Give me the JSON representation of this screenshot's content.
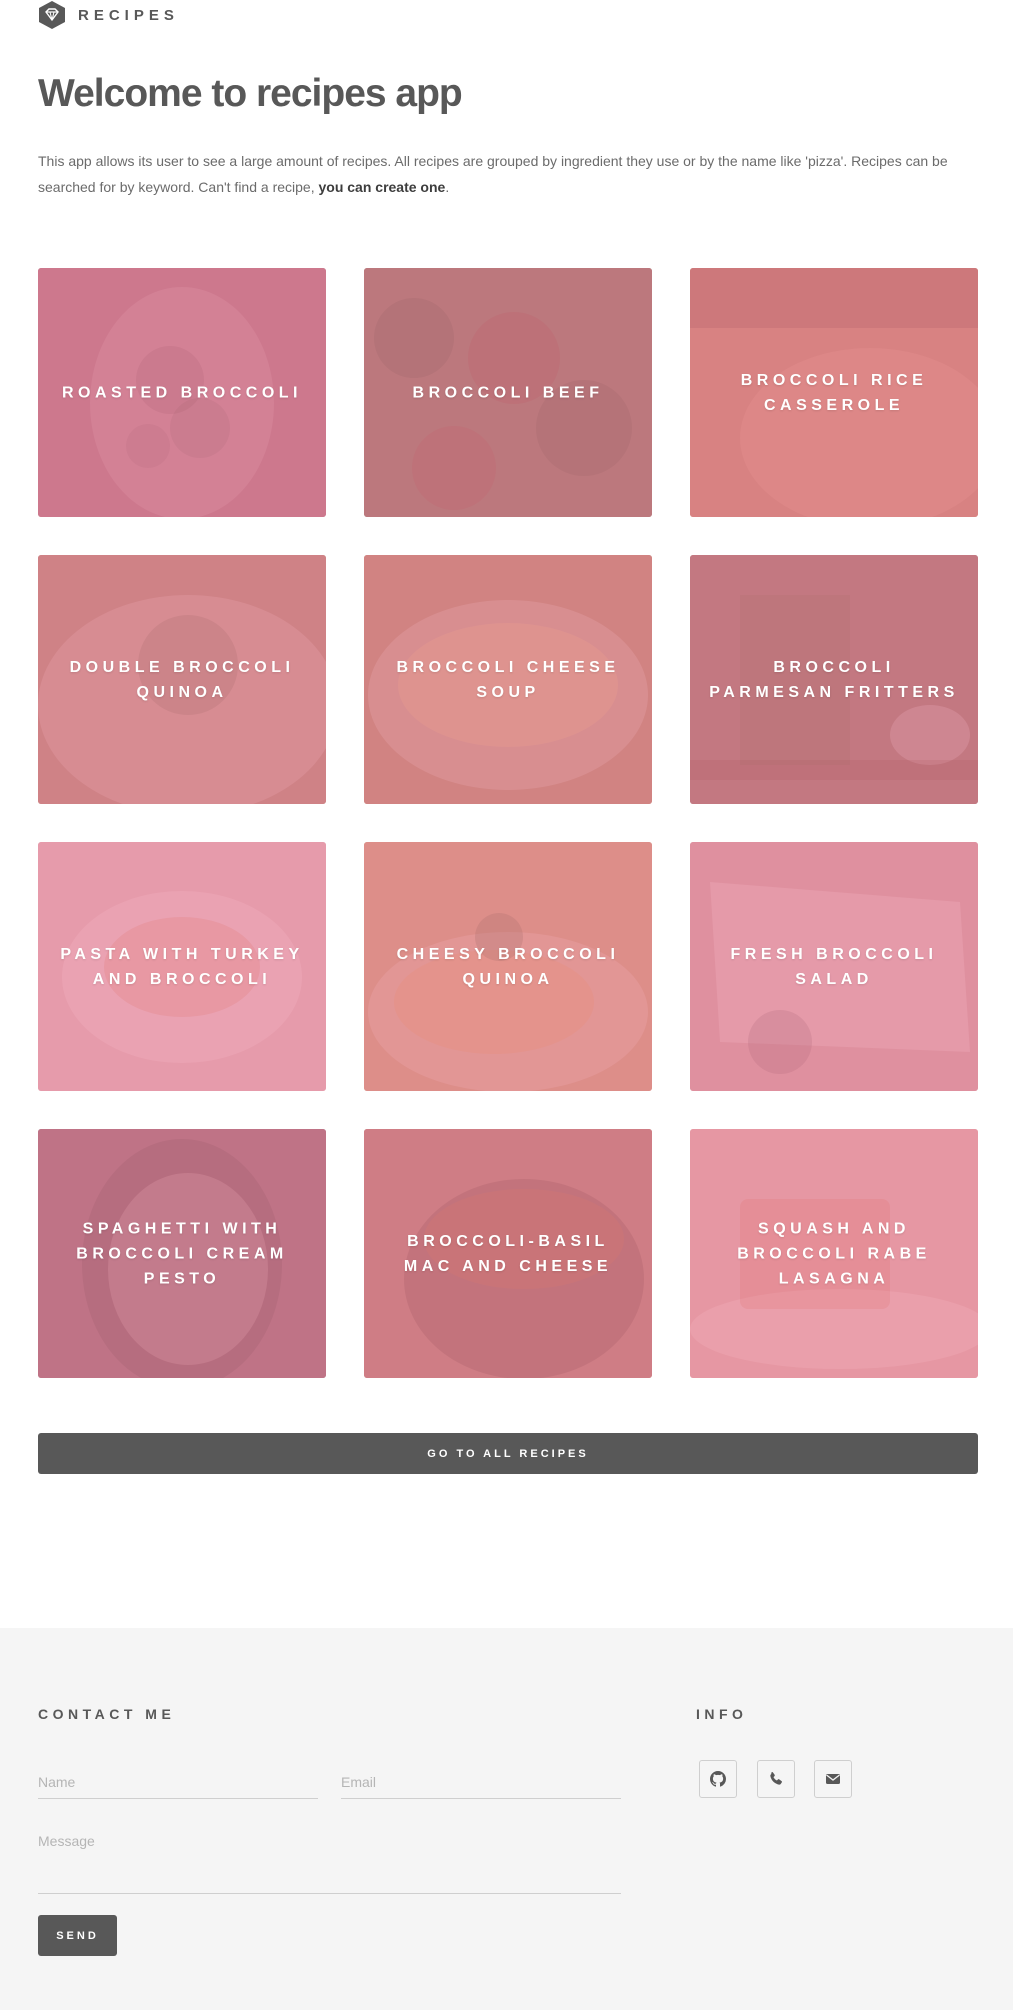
{
  "header": {
    "brand": "RECIPES",
    "logo_icon": "diamond-icon"
  },
  "main": {
    "title": "Welcome to recipes app",
    "intro_text": "This app allows its user to see a large amount of recipes. All recipes are grouped by ingredient they use or by the name like 'pizza'. Recipes can be searched for by keyword. Can't find a recipe, ",
    "intro_link": "you can create one",
    "intro_end": "."
  },
  "recipes": [
    {
      "title": "Roasted Broccoli",
      "base": "#a06a78"
    },
    {
      "title": "Broccoli Beef",
      "base": "#7a6a55"
    },
    {
      "title": "Broccoli Rice Casserole",
      "base": "#b88060"
    },
    {
      "title": "Double Broccoli Quinoa",
      "base": "#a58068"
    },
    {
      "title": "Broccoli Cheese Soup",
      "base": "#a88460"
    },
    {
      "title": "Broccoli Parmesan Fritters",
      "base": "#8a6a5e"
    },
    {
      "title": "Pasta with Turkey and Broccoli",
      "base": "#d8b8ba"
    },
    {
      "title": "Cheesy Broccoli Quinoa",
      "base": "#c49b70"
    },
    {
      "title": "Fresh Broccoli Salad",
      "base": "#c8a0a0"
    },
    {
      "title": "Spaghetti with Broccoli Cream Pesto",
      "base": "#806068"
    },
    {
      "title": "Broccoli-Basil Mac and Cheese",
      "base": "#9a6a58"
    },
    {
      "title": "Squash and Broccoli Rabe Lasagna",
      "base": "#d8b0a8"
    }
  ],
  "all_recipes_button": "GO TO ALL RECIPES",
  "footer": {
    "contact_heading": "CONTACT ME",
    "info_heading": "INFO",
    "name_placeholder": "Name",
    "email_placeholder": "Email",
    "message_placeholder": "Message",
    "send_label": "SEND",
    "icons": [
      "github-icon",
      "phone-icon",
      "envelope-icon"
    ]
  },
  "colors": {
    "text": "#585858",
    "button": "#585858",
    "card_tint": "#f2849e",
    "footer_bg": "#f5f5f5"
  }
}
